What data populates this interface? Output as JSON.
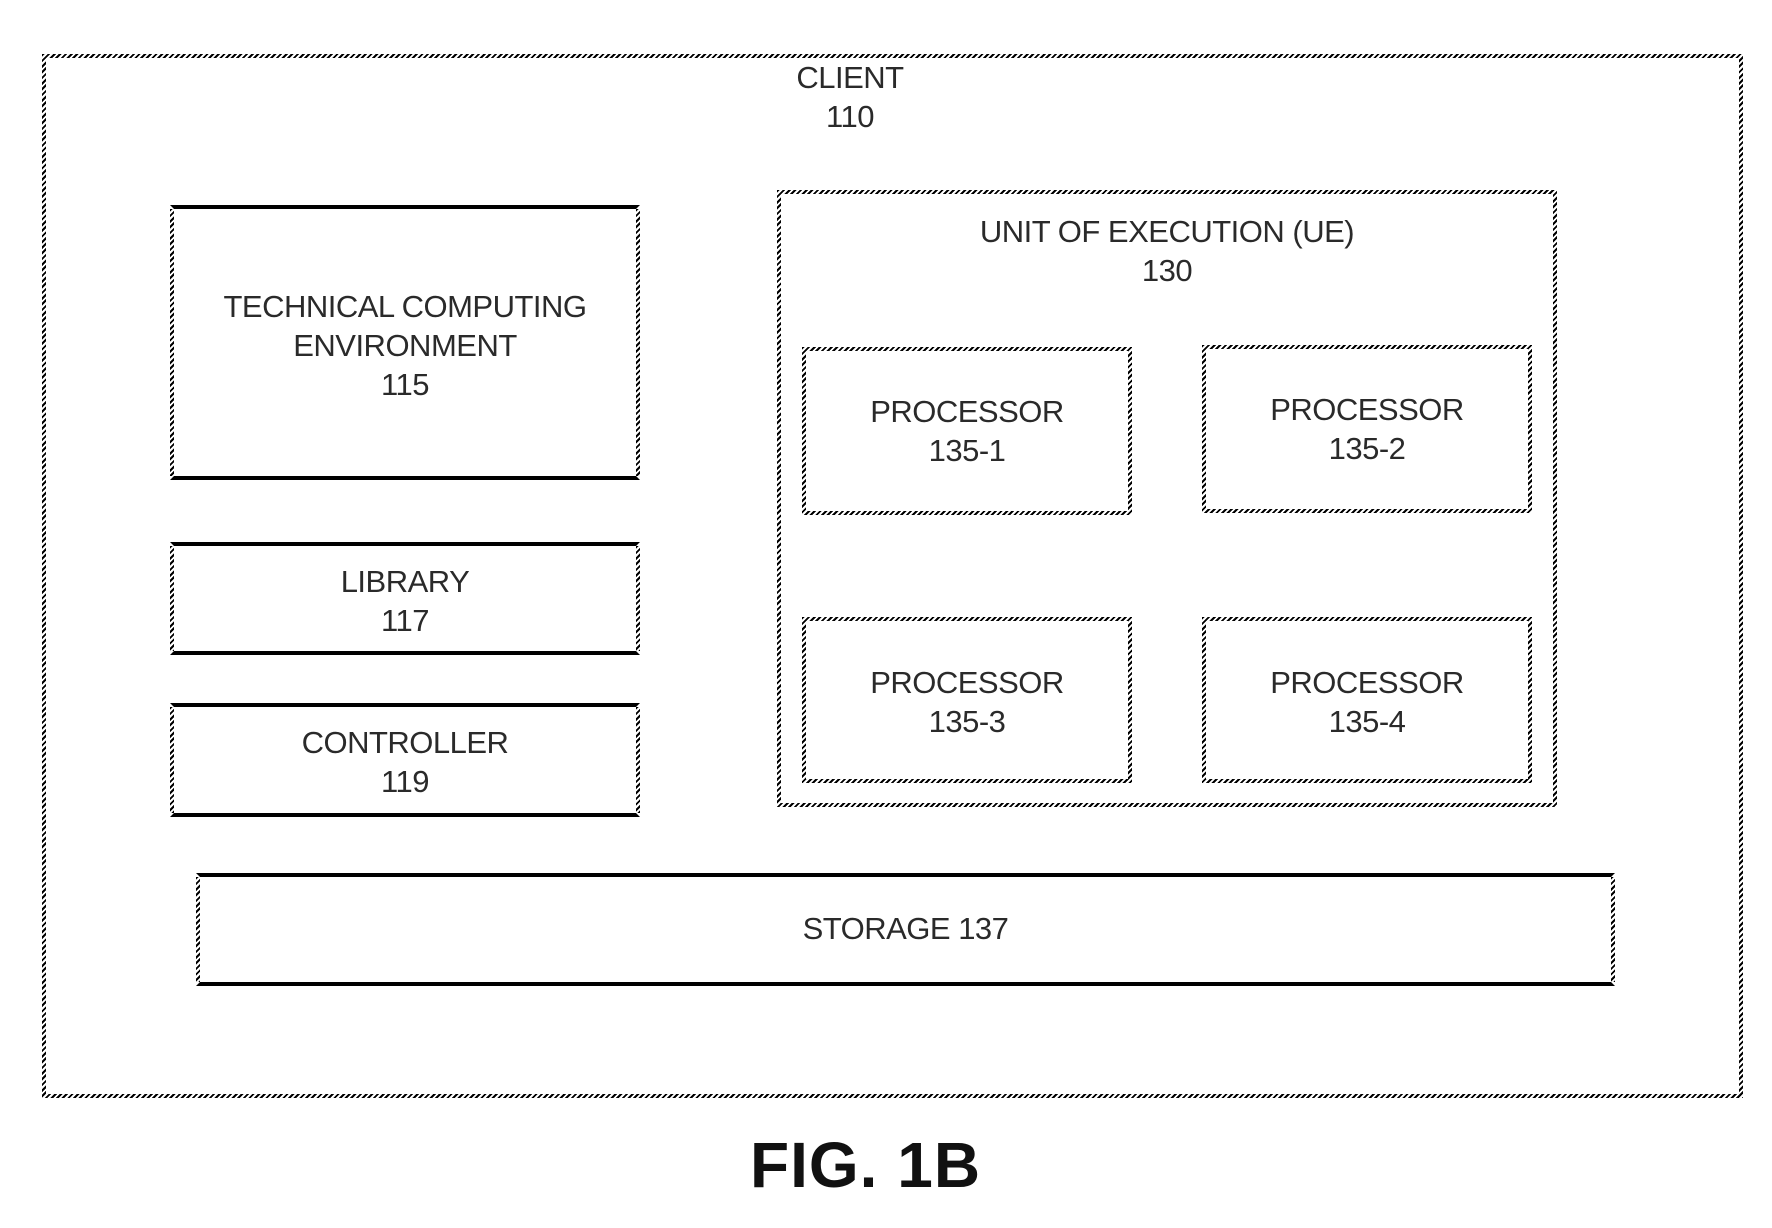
{
  "figure": {
    "caption": "FIG. 1B",
    "client": {
      "name": "CLIENT",
      "ref": "110"
    },
    "technical_computing_environment": {
      "line1": "TECHNICAL COMPUTING",
      "line2": "ENVIRONMENT",
      "ref": "115"
    },
    "library": {
      "name": "LIBRARY",
      "ref": "117"
    },
    "controller": {
      "name": "CONTROLLER",
      "ref": "119"
    },
    "unit_of_execution": {
      "name": "UNIT OF EXECUTION (UE)",
      "ref": "130"
    },
    "processors": [
      {
        "name": "PROCESSOR",
        "ref": "135-1"
      },
      {
        "name": "PROCESSOR",
        "ref": "135-2"
      },
      {
        "name": "PROCESSOR",
        "ref": "135-3"
      },
      {
        "name": "PROCESSOR",
        "ref": "135-4"
      }
    ],
    "storage": {
      "label": "STORAGE 137"
    }
  }
}
